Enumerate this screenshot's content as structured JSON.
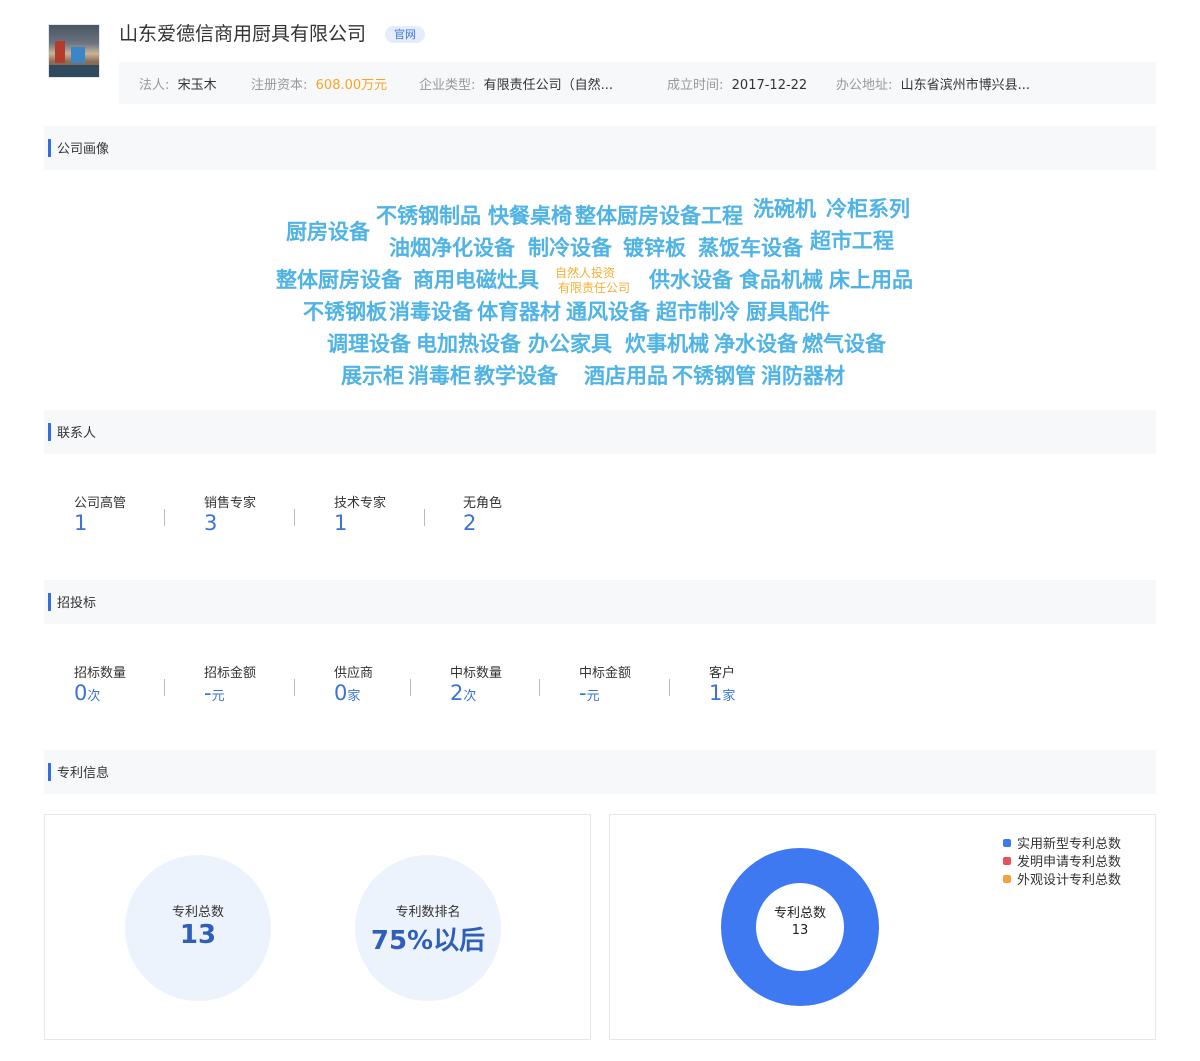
{
  "company": {
    "name": "山东爱德信商用厨具有限公司",
    "official_badge": "官网",
    "info": [
      {
        "label": "法人:",
        "value": "宋玉木"
      },
      {
        "label": "注册资本:",
        "value": "608.00万元"
      },
      {
        "label": "企业类型:",
        "value": "有限责任公司（自然..."
      },
      {
        "label": "成立时间:",
        "value": "2017-12-22"
      },
      {
        "label": "办公地址:",
        "value": "山东省滨州市博兴县..."
      }
    ]
  },
  "sections": {
    "profile": "公司画像",
    "contacts": "联系人",
    "bidding": "招投标",
    "patents": "专利信息"
  },
  "word_cloud": [
    "不锈钢制品",
    "快餐桌椅",
    "整体厨房设备工程",
    "洗碗机",
    "冷柜系列",
    "厨房设备",
    "油烟净化设备",
    "制冷设备",
    "镀锌板",
    "蒸饭车设备",
    "超市工程",
    "整体厨房设备",
    "商用电磁灶具",
    "供水设备",
    "食品机械",
    "床上用品",
    "不锈钢板",
    "消毒设备",
    "体育器材",
    "通风设备",
    "超市制冷",
    "厨具配件",
    "调理设备",
    "电加热设备",
    "办公家具",
    "炊事机械",
    "净水设备",
    "燃气设备",
    "展示柜",
    "消毒柜",
    "教学设备",
    "酒店用品",
    "不锈钢管",
    "消防器材"
  ],
  "word_cloud_small": [
    "自然人投资",
    "有限责任公司"
  ],
  "colors": {
    "accent": "#3b73d9",
    "word_cloud": "#4fb3e6",
    "highlight": "#f5a623"
  },
  "contacts": [
    {
      "label": "公司高管",
      "value": "1"
    },
    {
      "label": "销售专家",
      "value": "3"
    },
    {
      "label": "技术专家",
      "value": "1"
    },
    {
      "label": "无角色",
      "value": "2"
    }
  ],
  "bidding": [
    {
      "label": "招标数量",
      "value": "0",
      "unit": "次"
    },
    {
      "label": "招标金额",
      "value": "-",
      "unit": "元"
    },
    {
      "label": "供应商",
      "value": "0",
      "unit": "家"
    },
    {
      "label": "中标数量",
      "value": "2",
      "unit": "次"
    },
    {
      "label": "中标金额",
      "value": "-",
      "unit": "元"
    },
    {
      "label": "客户",
      "value": "1",
      "unit": "家"
    }
  ],
  "patents": {
    "total_label": "专利总数",
    "total_value": "13",
    "rank_label": "专利数排名",
    "rank_value": "75%以后",
    "donut_label": "专利总数",
    "donut_value": "13"
  },
  "chart_data": {
    "type": "pie",
    "categories": [
      "实用新型专利总数",
      "发明申请专利总数",
      "外观设计专利总数"
    ],
    "values": [
      13,
      0,
      0
    ],
    "colors": [
      "#3e79f2",
      "#e8505b",
      "#f5a340"
    ],
    "legend": "top-right"
  }
}
